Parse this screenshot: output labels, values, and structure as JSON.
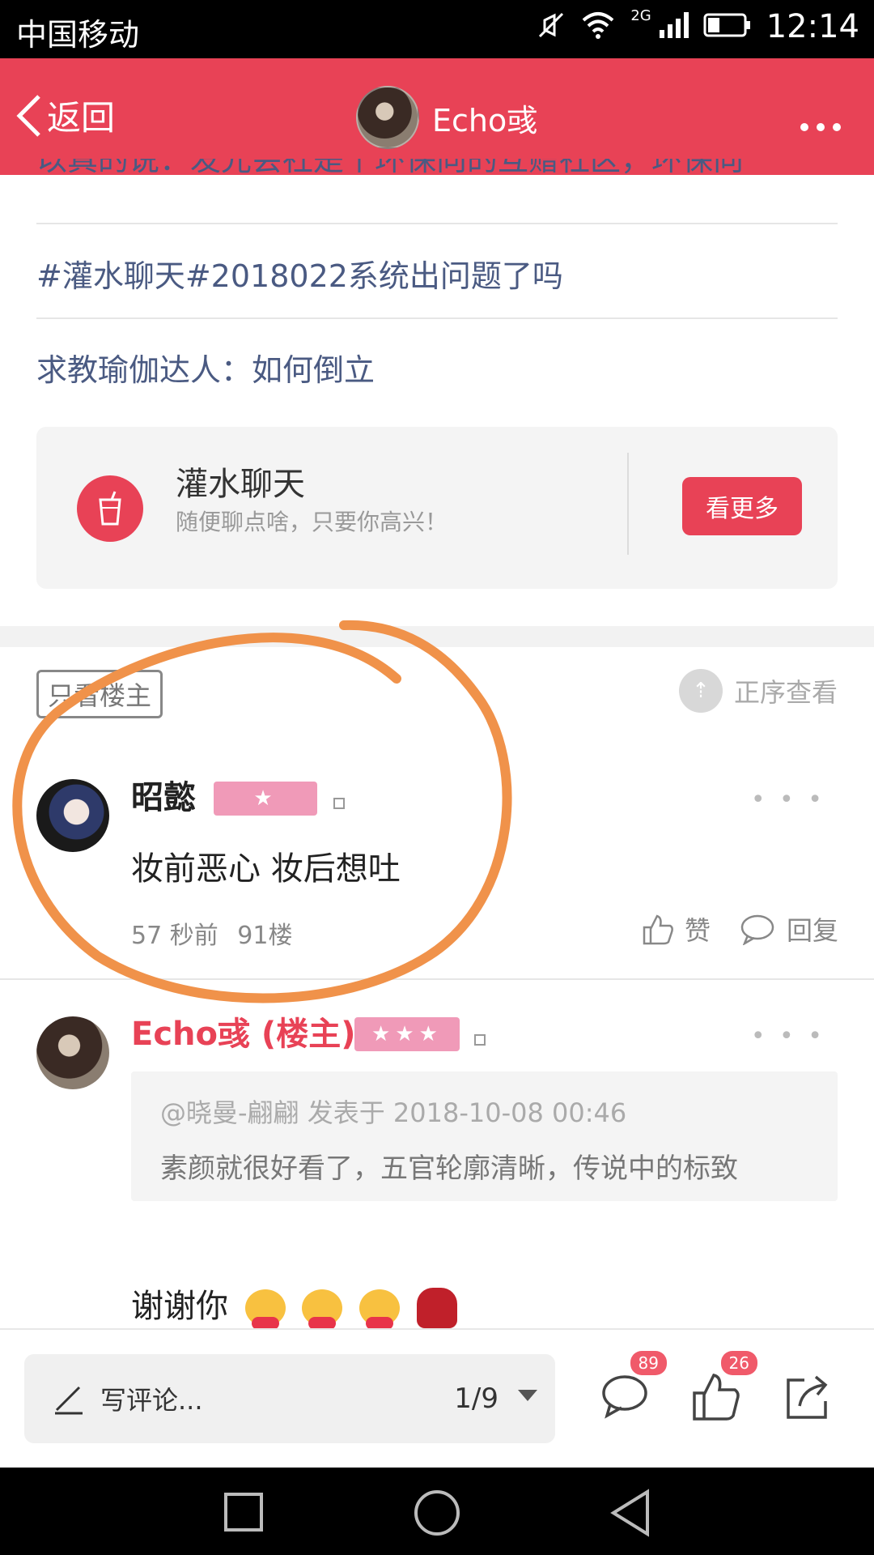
{
  "status_bar": {
    "carrier": "中国移动",
    "network": "2G",
    "time": "12:14"
  },
  "header": {
    "back_label": "返回",
    "user_name": "Echo彧"
  },
  "topics": [
    "以真的说：发光会社是个环保向的互赠社区，环保向",
    "#灌水聊天#2018022系统出问题了吗",
    "求教瑜伽达人：如何倒立"
  ],
  "community": {
    "name": "灌水聊天",
    "desc": "随便聊点啥，只要你高兴！",
    "see_more": "看更多"
  },
  "filter": {
    "only_host": "只看楼主",
    "order": "正序查看"
  },
  "comments": [
    {
      "user": "昭懿",
      "badge_stars": "★",
      "text": "妆前恶心 妆后想吐",
      "time": "57 秒前",
      "floor": "91楼",
      "like": "赞",
      "reply": "回复"
    },
    {
      "user": "Echo彧 (楼主)",
      "badge_stars": "★★★",
      "quote_header": "@晓曼-翩翩 发表于 2018-10-08 00:46",
      "quote_text": "素颜就很好看了，五官轮廓清晰，传说中的标致",
      "text": "谢谢你"
    }
  ],
  "bottom_bar": {
    "placeholder": "写评论...",
    "page": "1/9",
    "comment_count": "89",
    "like_count": "26"
  },
  "colors": {
    "accent": "#e84256",
    "badge": "#f09ab8",
    "annotation": "#f0924a"
  }
}
